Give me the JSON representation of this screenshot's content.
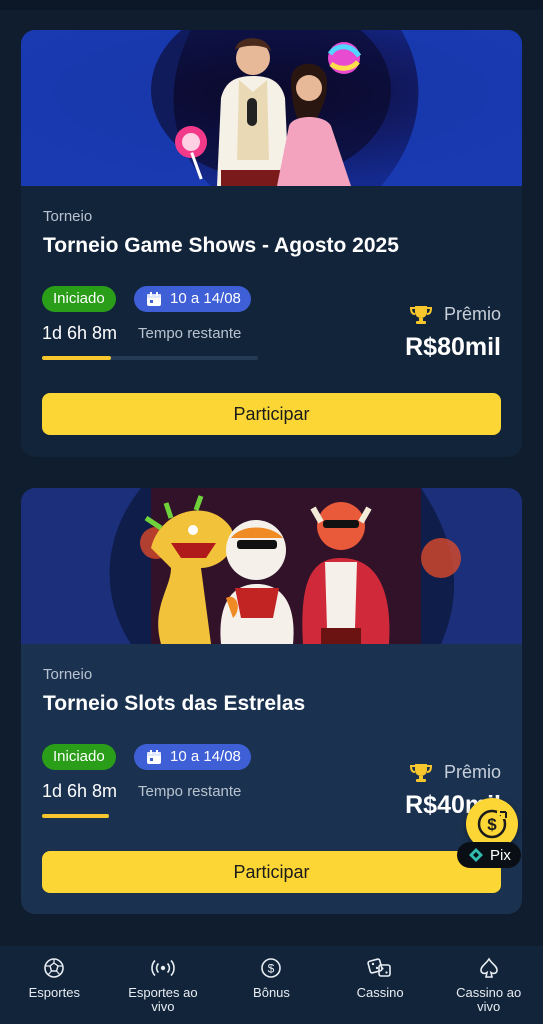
{
  "tournaments": [
    {
      "label": "Torneio",
      "title": "Torneio Game Shows - Agosto 2025",
      "status": "Iniciado",
      "dates": "10 a 14/08",
      "countdown": "1d 6h 8m",
      "countdown_label": "Tempo restante",
      "progress_fraction": 0.32,
      "prize_label": "Prêmio",
      "prize_value": "R$80mil",
      "cta": "Participar"
    },
    {
      "label": "Torneio",
      "title": "Torneio Slots das Estrelas",
      "status": "Iniciado",
      "dates": "10 a 14/08",
      "countdown": "1d 6h 8m",
      "countdown_label": "Tempo restante",
      "progress_fraction": 0.31,
      "prize_label": "Prêmio",
      "prize_value": "R$40mil",
      "cta": "Participar"
    }
  ],
  "pix_label": "Pix",
  "bottom_nav": [
    {
      "label": "Esportes",
      "icon": "soccer-ball-icon"
    },
    {
      "label": "Esportes ao vivo",
      "icon": "live-broadcast-icon"
    },
    {
      "label": "Bônus",
      "icon": "dollar-coin-icon"
    },
    {
      "label": "Cassino",
      "icon": "dice-icon"
    },
    {
      "label": "Cassino ao vivo",
      "icon": "spade-icon"
    }
  ],
  "colors": {
    "accent_yellow": "#fcd634",
    "status_green": "#2a9d19",
    "date_blue": "#3e5fd6",
    "background": "#0f1d2e"
  }
}
